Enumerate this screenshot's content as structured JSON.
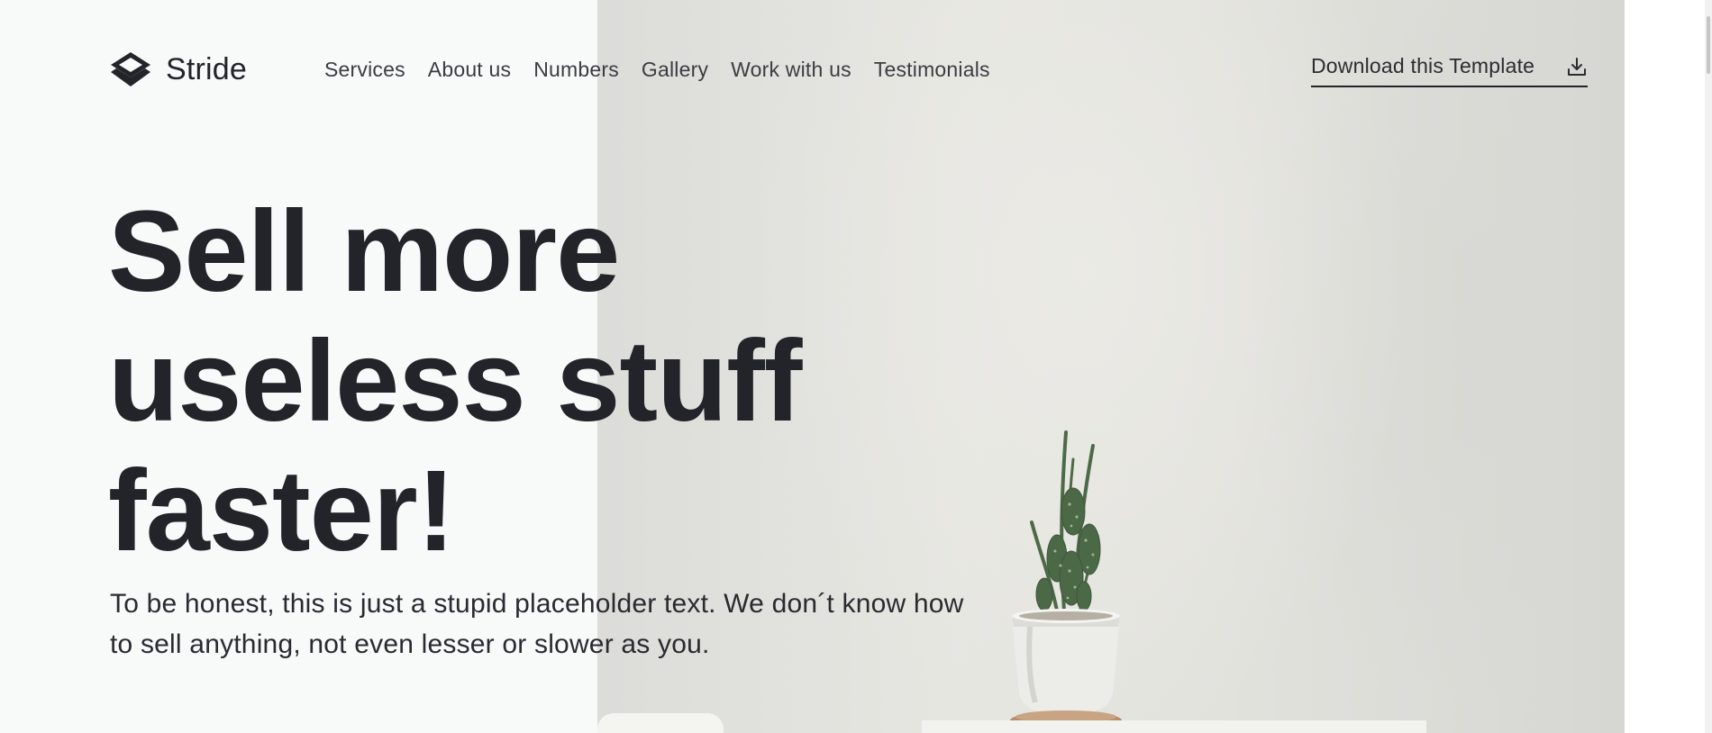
{
  "brand": {
    "name": "Stride",
    "icon": "layers-icon"
  },
  "nav": {
    "items": [
      {
        "label": "Services"
      },
      {
        "label": "About us"
      },
      {
        "label": "Numbers"
      },
      {
        "label": "Gallery"
      },
      {
        "label": "Work with us"
      },
      {
        "label": "Testimonials"
      }
    ]
  },
  "cta": {
    "label": "Download this Template",
    "icon": "download-icon"
  },
  "hero": {
    "headline": "Sell more useless stuff faster!",
    "subtext": "To be honest, this is just a stupid placeholder text. We don´t know how to sell anything, not even lesser or slower as you."
  },
  "colors": {
    "text": "#23232a",
    "background": "#f8f9f9",
    "image_wall": "#e2e2dd"
  }
}
